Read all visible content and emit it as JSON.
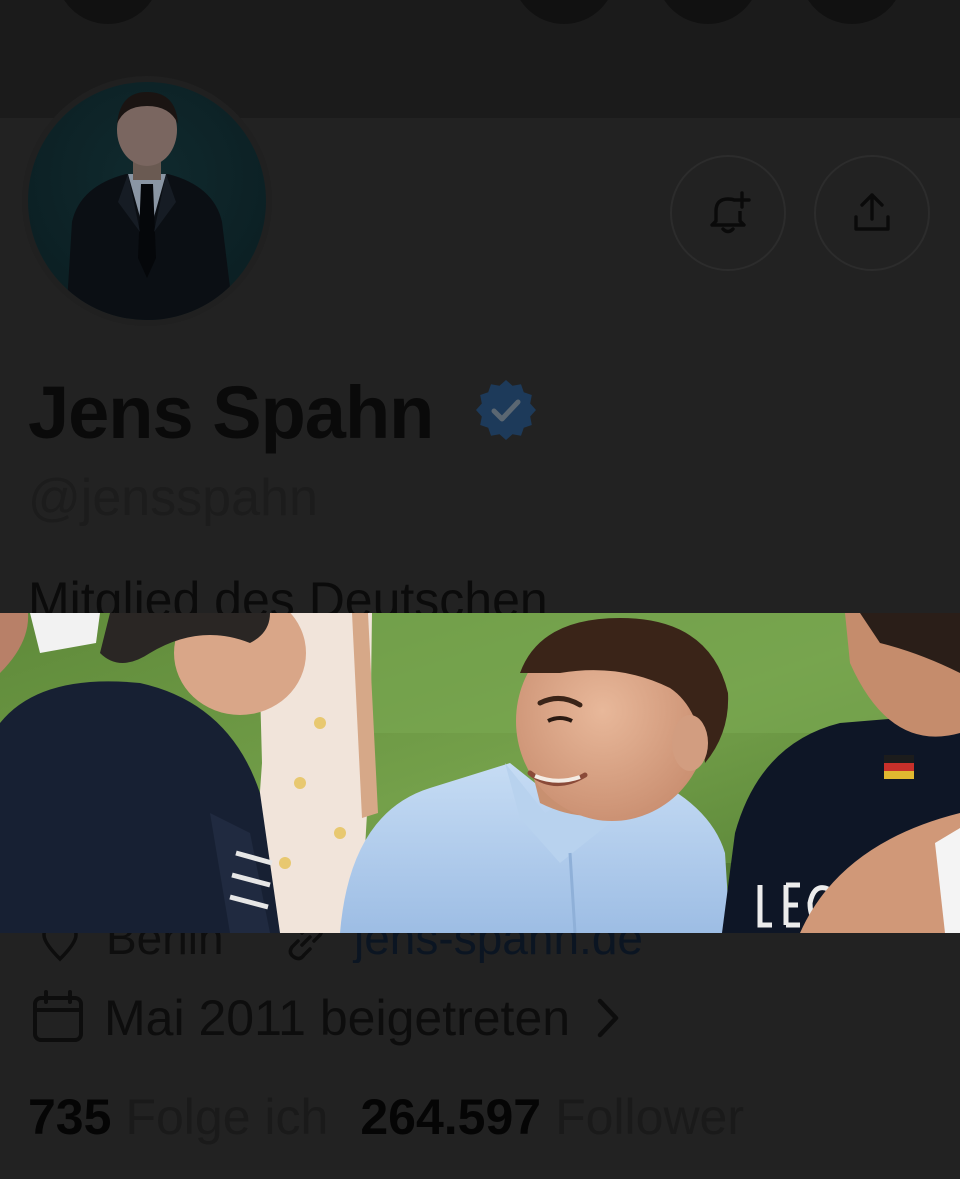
{
  "profile": {
    "display_name": "Jens Spahn",
    "handle": "@jensspahn",
    "bio_partial": "Mitglied des Deutschen",
    "location": "Berlin",
    "website": "jens-spahn.de",
    "joined": "Mai 2011 beigetreten",
    "following_count": "735",
    "following_label": "Folge ich",
    "followers_count": "264.597",
    "followers_label": "Follower"
  },
  "icons": {
    "notify": "bell-plus-icon",
    "share": "share-icon",
    "verified": "verified-badge-icon",
    "location": "location-pin-icon",
    "link": "link-icon",
    "calendar": "calendar-icon",
    "chevron": "chevron-right-icon"
  },
  "colors": {
    "verified": "#1d3a5a",
    "background": "#222222",
    "header": "#1b1b1b"
  }
}
